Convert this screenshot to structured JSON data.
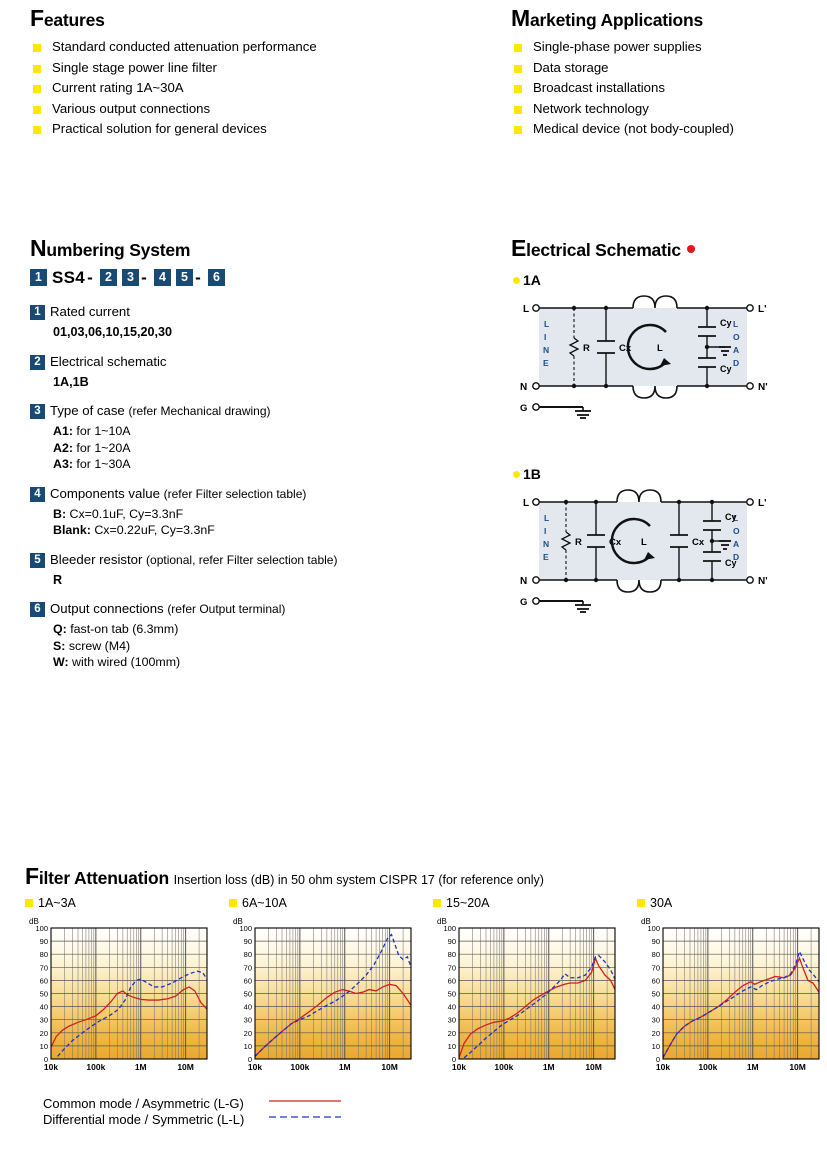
{
  "features": {
    "title_initial": "F",
    "title_rest": "eatures",
    "items": [
      "Standard conducted attenuation performance",
      "Single stage power line filter",
      "Current rating 1A~30A",
      "Various output connections",
      "Practical solution for general devices"
    ]
  },
  "marketing": {
    "title_initial": "M",
    "title_rest": "arketing Applications",
    "items": [
      "Single-phase power supplies",
      "Data storage",
      "Broadcast installations",
      "Network technology",
      "Medical device (not body-coupled)"
    ]
  },
  "numbering": {
    "title_initial": "N",
    "title_rest": "umbering System",
    "code": {
      "b1": "1",
      "prefix": "SS4",
      "dash1": "-",
      "b2": "2",
      "b3": "3",
      "dash2": "-",
      "b4": "4",
      "b5": "5",
      "dash3": "-",
      "b6": "6"
    },
    "blocks": [
      {
        "badge": "1",
        "head": "Rated current",
        "paren": "",
        "lines": [
          {
            "bold": "01,03,06,10,15,20,30",
            "rest": "",
            "all_bold": true
          }
        ]
      },
      {
        "badge": "2",
        "head": "Electrical schematic",
        "paren": "",
        "lines": [
          {
            "bold": "1A,1B",
            "rest": "",
            "all_bold": true
          }
        ]
      },
      {
        "badge": "3",
        "head": "Type of case",
        "paren": "(refer Mechanical drawing)",
        "lines": [
          {
            "bold": "A1:",
            "rest": " for 1~10A",
            "all_bold": false
          },
          {
            "bold": "A2:",
            "rest": " for 1~20A",
            "all_bold": false
          },
          {
            "bold": "A3:",
            "rest": " for 1~30A",
            "all_bold": false
          }
        ]
      },
      {
        "badge": "4",
        "head": "Components value",
        "paren": "(refer Filter selection table)",
        "lines": [
          {
            "bold": "B:",
            "rest": " Cx=0.1uF, Cy=3.3nF",
            "all_bold": false
          },
          {
            "bold": "Blank:",
            "rest": " Cx=0.22uF, Cy=3.3nF",
            "all_bold": false
          }
        ]
      },
      {
        "badge": "5",
        "head": "Bleeder resistor",
        "paren": "(optional, refer Filter selection table)",
        "lines": [
          {
            "bold": "R",
            "rest": "",
            "all_bold": true
          }
        ]
      },
      {
        "badge": "6",
        "head": "Output connections",
        "paren": "(refer Output terminal)",
        "lines": [
          {
            "bold": "Q:",
            "rest": " fast-on tab (6.3mm)",
            "all_bold": false
          },
          {
            "bold": "S:",
            "rest": " screw (M4)",
            "all_bold": false
          },
          {
            "bold": "W:",
            "rest": " with wired (100mm)",
            "all_bold": false
          }
        ]
      }
    ]
  },
  "schematic": {
    "title_initial": "E",
    "title_rest": "lectrical Schematic",
    "variants": [
      {
        "name": "1A",
        "terminals": {
          "in_top": "L",
          "in_bottom": "N",
          "out_top": "L'",
          "out_bottom": "N'",
          "ground": "G"
        },
        "left_word": "LINE",
        "right_word": "LOAD",
        "components": [
          "R",
          "Cx",
          "L",
          "Cy",
          "Cy"
        ]
      },
      {
        "name": "1B",
        "terminals": {
          "in_top": "L",
          "in_bottom": "N",
          "out_top": "L'",
          "out_bottom": "N'",
          "ground": "G"
        },
        "left_word": "LINE",
        "right_word": "LOAD",
        "components": [
          "R",
          "Cx",
          "L",
          "Cx",
          "Cy",
          "Cy"
        ]
      }
    ]
  },
  "attenuation": {
    "title_initial": "F",
    "title_rest": "ilter Attenuation",
    "subtitle": "Insertion loss (dB) in 50 ohm system CISPR 17 (for reference only)",
    "legend": [
      {
        "label": "Common mode / Asymmetric (L-G)",
        "style": "solid",
        "color": "#d02020"
      },
      {
        "label": "Differential mode / Symmetric (L-L)",
        "style": "dashed",
        "color": "#2030cc"
      }
    ]
  },
  "chart_data": [
    {
      "type": "line",
      "title": "1A~3A",
      "ylabel": "dB",
      "xlabel": "",
      "ylim": [
        0,
        100
      ],
      "yticks": [
        0,
        10,
        20,
        30,
        40,
        50,
        60,
        70,
        80,
        90,
        100
      ],
      "xlim": [
        10000,
        30000000
      ],
      "xticks": [
        10000,
        100000,
        1000000,
        10000000
      ],
      "xticklabels": [
        "10k",
        "100k",
        "1M",
        "10M"
      ],
      "xscale": "log",
      "grid": true,
      "series": [
        {
          "name": "Common mode / Asymmetric (L-G)",
          "color": "#d02020",
          "style": "solid",
          "x": [
            10000,
            13000,
            18000,
            25000,
            40000,
            60000,
            100000,
            150000,
            220000,
            300000,
            400000,
            500000,
            700000,
            1000000,
            1500000,
            2500000,
            4000000,
            6000000,
            9000000,
            12000000,
            16000000,
            22000000,
            30000000
          ],
          "y": [
            9,
            17,
            22,
            25,
            28,
            30,
            33,
            38,
            44,
            50,
            52,
            49,
            47,
            45.5,
            45,
            45,
            46,
            48,
            53,
            55,
            52,
            43,
            38
          ]
        },
        {
          "name": "Differential mode / Symmetric (L-L)",
          "color": "#2030cc",
          "style": "dashed",
          "x": [
            14000,
            20000,
            30000,
            50000,
            80000,
            120000,
            200000,
            320000,
            450000,
            600000,
            800000,
            1000000,
            1400000,
            2000000,
            3000000,
            5000000,
            8000000,
            12000000,
            18000000,
            24000000,
            30000000
          ],
          "y": [
            2,
            8,
            14,
            20,
            25,
            29,
            33,
            38,
            45,
            55,
            60,
            61,
            58,
            55,
            55,
            58,
            62,
            65,
            67,
            66,
            61
          ]
        }
      ]
    },
    {
      "type": "line",
      "title": "6A~10A",
      "ylabel": "dB",
      "xlabel": "",
      "ylim": [
        0,
        100
      ],
      "yticks": [
        0,
        10,
        20,
        30,
        40,
        50,
        60,
        70,
        80,
        90,
        100
      ],
      "xlim": [
        10000,
        30000000
      ],
      "xticks": [
        10000,
        100000,
        1000000,
        10000000
      ],
      "xticklabels": [
        "10k",
        "100k",
        "1M",
        "10M"
      ],
      "xscale": "log",
      "grid": true,
      "series": [
        {
          "name": "Common mode / Asymmetric (L-G)",
          "color": "#d02020",
          "style": "solid",
          "x": [
            10000,
            15000,
            25000,
            40000,
            65000,
            100000,
            160000,
            250000,
            400000,
            600000,
            900000,
            1200000,
            1800000,
            2500000,
            3500000,
            5000000,
            7000000,
            10000000,
            14000000,
            20000000,
            30000000
          ],
          "y": [
            2,
            8,
            15,
            21,
            27,
            31,
            36,
            41,
            47,
            51,
            53,
            52,
            50,
            51,
            53,
            52,
            55,
            57,
            56,
            50,
            41
          ]
        },
        {
          "name": "Differential mode / Symmetric (L-L)",
          "color": "#2030cc",
          "style": "dashed",
          "x": [
            10000,
            15000,
            25000,
            40000,
            65000,
            100000,
            160000,
            250000,
            400000,
            600000,
            900000,
            1300000,
            2000000,
            3000000,
            4500000,
            6500000,
            9000000,
            11000000,
            13000000,
            16000000,
            20000000,
            25000000,
            30000000
          ],
          "y": [
            2,
            8,
            15,
            21,
            27,
            30,
            33,
            37,
            41,
            44,
            48,
            52,
            58,
            64,
            72,
            82,
            92,
            95,
            88,
            79,
            76,
            78,
            70
          ]
        }
      ]
    },
    {
      "type": "line",
      "title": "15~20A",
      "ylabel": "dB",
      "xlabel": "",
      "ylim": [
        0,
        100
      ],
      "yticks": [
        0,
        10,
        20,
        30,
        40,
        50,
        60,
        70,
        80,
        90,
        100
      ],
      "xlim": [
        10000,
        30000000
      ],
      "xticks": [
        10000,
        100000,
        1000000,
        10000000
      ],
      "xticklabels": [
        "10k",
        "100k",
        "1M",
        "10M"
      ],
      "xscale": "log",
      "grid": true,
      "series": [
        {
          "name": "Common mode / Asymmetric (L-G)",
          "color": "#d02020",
          "style": "solid",
          "x": [
            10000,
            13000,
            18000,
            26000,
            40000,
            60000,
            90000,
            130000,
            200000,
            300000,
            450000,
            700000,
            1000000,
            1500000,
            2200000,
            3000000,
            4500000,
            6500000,
            9000000,
            11000000,
            13000000,
            18000000,
            24000000,
            30000000
          ],
          "y": [
            1,
            12,
            19,
            23,
            26,
            28,
            29,
            31,
            35,
            40,
            45,
            49,
            52,
            55,
            57,
            58,
            58,
            60,
            66,
            77,
            71,
            64,
            60,
            53
          ]
        },
        {
          "name": "Differential mode / Symmetric (L-L)",
          "color": "#2030cc",
          "style": "dashed",
          "x": [
            13000,
            18000,
            26000,
            40000,
            60000,
            90000,
            140000,
            220000,
            350000,
            550000,
            850000,
            1300000,
            1800000,
            2300000,
            3000000,
            4500000,
            6500000,
            9000000,
            11000000,
            13000000,
            18000000,
            24000000,
            30000000
          ],
          "y": [
            1,
            5,
            10,
            16,
            21,
            26,
            30,
            34,
            39,
            44,
            49,
            55,
            60,
            65,
            62,
            62,
            64,
            70,
            78,
            79,
            74,
            68,
            61
          ]
        }
      ]
    },
    {
      "type": "line",
      "title": "30A",
      "ylabel": "dB",
      "xlabel": "",
      "ylim": [
        0,
        100
      ],
      "yticks": [
        0,
        10,
        20,
        30,
        40,
        50,
        60,
        70,
        80,
        90,
        100
      ],
      "xlim": [
        10000,
        30000000
      ],
      "xticks": [
        10000,
        100000,
        1000000,
        10000000
      ],
      "xticklabels": [
        "10k",
        "100k",
        "1M",
        "10M"
      ],
      "xscale": "log",
      "grid": true,
      "series": [
        {
          "name": "Common mode / Asymmetric (L-G)",
          "color": "#d02020",
          "style": "solid",
          "x": [
            10000,
            14000,
            20000,
            30000,
            45000,
            70000,
            110000,
            170000,
            260000,
            400000,
            600000,
            900000,
            1100000,
            1500000,
            2200000,
            3200000,
            5000000,
            7000000,
            9000000,
            11000000,
            13000000,
            17000000,
            22000000,
            30000000
          ],
          "y": [
            1,
            10,
            19,
            25,
            29,
            32,
            36,
            40,
            45,
            51,
            56,
            59,
            57,
            59,
            61,
            63,
            62,
            64,
            70,
            77,
            70,
            60,
            58,
            51
          ]
        },
        {
          "name": "Differential mode / Symmetric (L-L)",
          "color": "#2030cc",
          "style": "dashed",
          "x": [
            10000,
            14000,
            20000,
            30000,
            45000,
            70000,
            110000,
            170000,
            260000,
            400000,
            600000,
            900000,
            1200000,
            1600000,
            2400000,
            3500000,
            5000000,
            7000000,
            9000000,
            11000000,
            13000000,
            17000000,
            23000000,
            30000000
          ],
          "y": [
            1,
            10,
            19,
            25,
            29,
            32,
            36,
            40,
            44,
            48,
            52,
            55,
            53,
            56,
            59,
            61,
            62,
            65,
            72,
            82,
            77,
            69,
            64,
            59
          ]
        }
      ]
    }
  ]
}
